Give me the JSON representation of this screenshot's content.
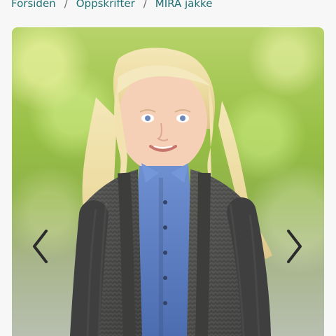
{
  "breadcrumb": {
    "items": [
      {
        "label": "Forsiden"
      },
      {
        "label": "Oppskrifter"
      },
      {
        "label": "MIRA jakke"
      }
    ],
    "separator": "/"
  },
  "gallery": {
    "image_alt": "girl-wearing-grey-knitted-cardigan",
    "prev_icon": "chevron-left-icon",
    "next_icon": "chevron-right-icon"
  },
  "colors": {
    "link": "#1f6f73",
    "arrow": "#2b2b2b",
    "cardigan": "#4f4f4d",
    "shirt": "#5f7fc0"
  }
}
